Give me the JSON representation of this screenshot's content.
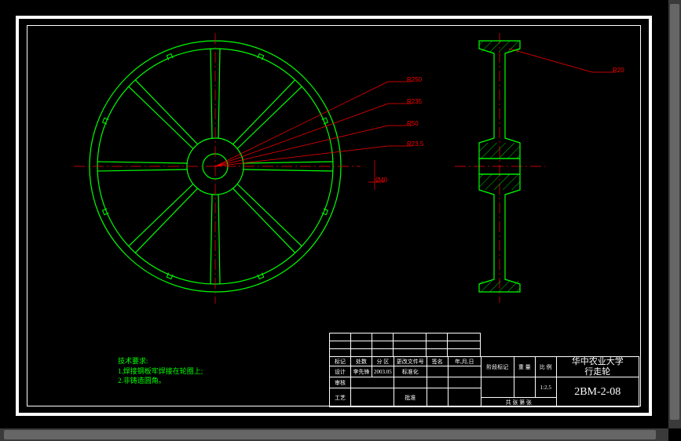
{
  "dimensions": {
    "d1": "R250",
    "d2": "R235",
    "d3": "R50",
    "d4": "R23.5",
    "d5": "Ø40",
    "d6": "R20"
  },
  "notes": {
    "title": "技术要求:",
    "line1": "1.焊接钢板牢焊接在轮圈上;",
    "line2": "2.非铸造圆角。"
  },
  "title_block": {
    "r1": {
      "c1": "标记",
      "c2": "处数",
      "c3": "分 区",
      "c4": "更改文件号",
      "c5": "签名",
      "c6": "年,月,日"
    },
    "r2": {
      "c1": "设计",
      "c2": "李先锋",
      "c3": "2003.05",
      "c4": "标准化",
      "c5": "",
      "c6": ""
    },
    "r3": {
      "c1": "审核",
      "c2": "",
      "c3": "",
      "c4": "",
      "c5": "",
      "c6": ""
    },
    "r4": {
      "c1": "工艺",
      "c2": "",
      "c3": "",
      "c4": "批准",
      "c5": "",
      "c6": ""
    },
    "side": {
      "h1": "阶段标记",
      "h2": "重 量",
      "h3": "比 例",
      "v1": "",
      "v2": "",
      "v3": "1:2.5",
      "sh": "共  张  第    张"
    },
    "org_line1": "华中农业大学",
    "org_line2": "行走轮",
    "part_no": "2BM-2-08"
  }
}
